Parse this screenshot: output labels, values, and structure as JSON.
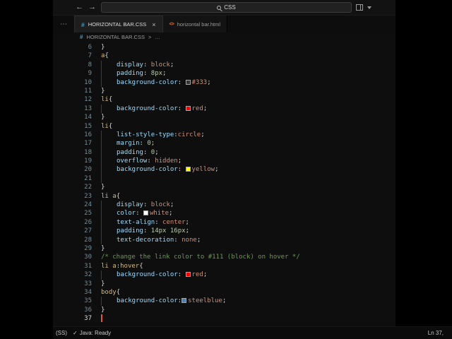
{
  "colors": {
    "selector": "#d7ba7d",
    "property": "#9cdcfe",
    "value_keyword": "#ce9178",
    "number": "#b5cea8",
    "comment": "#6a9955",
    "punctuation": "#d4d4d4",
    "cursor": "#e5533d",
    "css_file_icon": "#519aba",
    "html_file_icon": "#e37933"
  },
  "title_bar": {
    "back_icon": "←",
    "forward_icon": "→",
    "search_value": "CSS"
  },
  "tab_bar": {
    "ellipsis": "⋯",
    "tabs": [
      {
        "icon": "#",
        "label": "HORIZONTAL BAR.CSS",
        "close": "×",
        "active": true
      },
      {
        "icon": "<>",
        "label": "horizontal bar.html",
        "active": false
      }
    ]
  },
  "breadcrumb": {
    "icon": "#",
    "file": "HORIZONTAL BAR.CSS",
    "separator": ">",
    "more": "…"
  },
  "editor": {
    "lines": [
      {
        "n": 6,
        "t": [
          [
            "}",
            "punct"
          ]
        ]
      },
      {
        "n": 7,
        "t": [
          [
            "a",
            "sel"
          ],
          [
            "{",
            "punct"
          ]
        ]
      },
      {
        "n": 8,
        "i": 1,
        "t": [
          [
            "display",
            "prop"
          ],
          [
            ": ",
            "punct"
          ],
          [
            "block",
            "val"
          ],
          [
            ";",
            "punct"
          ]
        ]
      },
      {
        "n": 9,
        "i": 1,
        "t": [
          [
            "padding",
            "prop"
          ],
          [
            ": ",
            "punct"
          ],
          [
            "8px",
            "num"
          ],
          [
            ";",
            "punct"
          ]
        ]
      },
      {
        "n": 10,
        "i": 1,
        "t": [
          [
            "background-color",
            "prop"
          ],
          [
            ": ",
            "punct"
          ],
          [
            "",
            "swatch",
            "#333333"
          ],
          [
            "#333",
            "val"
          ],
          [
            ";",
            "punct"
          ]
        ]
      },
      {
        "n": 11,
        "t": [
          [
            "}",
            "punct"
          ]
        ]
      },
      {
        "n": 12,
        "t": [
          [
            "li",
            "sel"
          ],
          [
            "{",
            "punct"
          ]
        ]
      },
      {
        "n": 13,
        "i": 1,
        "t": [
          [
            "background-color",
            "prop"
          ],
          [
            ": ",
            "punct"
          ],
          [
            "",
            "swatch",
            "#ff0000"
          ],
          [
            "red",
            "val"
          ],
          [
            ";",
            "punct"
          ]
        ]
      },
      {
        "n": 14,
        "t": [
          [
            "}",
            "punct"
          ]
        ]
      },
      {
        "n": 15,
        "t": [
          [
            "li",
            "sel"
          ],
          [
            "{",
            "punct"
          ]
        ]
      },
      {
        "n": 16,
        "i": 1,
        "t": [
          [
            "list-style-type",
            "prop"
          ],
          [
            ":",
            "punct"
          ],
          [
            "circle",
            "val"
          ],
          [
            ";",
            "punct"
          ]
        ]
      },
      {
        "n": 17,
        "i": 1,
        "t": [
          [
            "margin",
            "prop"
          ],
          [
            ": ",
            "punct"
          ],
          [
            "0",
            "num"
          ],
          [
            ";",
            "punct"
          ]
        ]
      },
      {
        "n": 18,
        "i": 1,
        "t": [
          [
            "padding",
            "prop"
          ],
          [
            ": ",
            "punct"
          ],
          [
            "0",
            "num"
          ],
          [
            ";",
            "punct"
          ]
        ]
      },
      {
        "n": 19,
        "i": 1,
        "t": [
          [
            "overflow",
            "prop"
          ],
          [
            ": ",
            "punct"
          ],
          [
            "hidden",
            "val"
          ],
          [
            ";",
            "punct"
          ]
        ]
      },
      {
        "n": 20,
        "i": 1,
        "t": [
          [
            "background-color",
            "prop"
          ],
          [
            ": ",
            "punct"
          ],
          [
            "",
            "swatch",
            "#ffff00"
          ],
          [
            "yellow",
            "val"
          ],
          [
            ";",
            "punct"
          ]
        ]
      },
      {
        "n": 21,
        "i": 1,
        "t": []
      },
      {
        "n": 22,
        "t": [
          [
            "}",
            "punct"
          ]
        ]
      },
      {
        "n": 23,
        "t": [
          [
            "li a",
            "sel"
          ],
          [
            "{",
            "punct"
          ]
        ]
      },
      {
        "n": 24,
        "i": 1,
        "t": [
          [
            "display",
            "prop"
          ],
          [
            ": ",
            "punct"
          ],
          [
            "block",
            "val"
          ],
          [
            ";",
            "punct"
          ]
        ]
      },
      {
        "n": 25,
        "i": 1,
        "t": [
          [
            "color",
            "prop"
          ],
          [
            ": ",
            "punct"
          ],
          [
            "",
            "swatch",
            "#ffffff"
          ],
          [
            "white",
            "val"
          ],
          [
            ";",
            "punct"
          ]
        ]
      },
      {
        "n": 26,
        "i": 1,
        "t": [
          [
            "text-align",
            "prop"
          ],
          [
            ": ",
            "punct"
          ],
          [
            "center",
            "val"
          ],
          [
            ";",
            "punct"
          ]
        ]
      },
      {
        "n": 27,
        "i": 1,
        "t": [
          [
            "padding",
            "prop"
          ],
          [
            ": ",
            "punct"
          ],
          [
            "14px 16px",
            "num"
          ],
          [
            ";",
            "punct"
          ]
        ]
      },
      {
        "n": 28,
        "i": 1,
        "t": [
          [
            "text-decoration",
            "prop"
          ],
          [
            ": ",
            "punct"
          ],
          [
            "none",
            "val"
          ],
          [
            ";",
            "punct"
          ]
        ]
      },
      {
        "n": 29,
        "t": [
          [
            "}",
            "punct"
          ]
        ]
      },
      {
        "n": 30,
        "t": [
          [
            "/* change the link color to #111 (block) on hover */",
            "comment"
          ]
        ]
      },
      {
        "n": 31,
        "t": [
          [
            "li a",
            "sel"
          ],
          [
            ":",
            "punct"
          ],
          [
            "hover",
            "sel"
          ],
          [
            "{",
            "punct"
          ]
        ]
      },
      {
        "n": 32,
        "i": 1,
        "t": [
          [
            "background-color",
            "prop"
          ],
          [
            ": ",
            "punct"
          ],
          [
            "",
            "swatch",
            "#ff0000"
          ],
          [
            "red",
            "val"
          ],
          [
            ";",
            "punct"
          ]
        ]
      },
      {
        "n": 33,
        "t": [
          [
            "}",
            "punct"
          ]
        ]
      },
      {
        "n": 34,
        "t": [
          [
            "body",
            "sel"
          ],
          [
            "{",
            "punct"
          ]
        ]
      },
      {
        "n": 35,
        "i": 1,
        "t": [
          [
            "background-color",
            "prop"
          ],
          [
            ":",
            "punct"
          ],
          [
            "",
            "swatch",
            "#4682b4"
          ],
          [
            "steelblue",
            "val"
          ],
          [
            ";",
            "punct"
          ]
        ]
      },
      {
        "n": 36,
        "t": [
          [
            "}",
            "punct"
          ]
        ]
      },
      {
        "n": 37,
        "active": true,
        "cursor": true,
        "t": []
      }
    ]
  },
  "status_bar": {
    "left_badge": "(SS)",
    "java_icon": "✓",
    "java_label": "Java: Ready",
    "cursor_position": "Ln 37,"
  }
}
